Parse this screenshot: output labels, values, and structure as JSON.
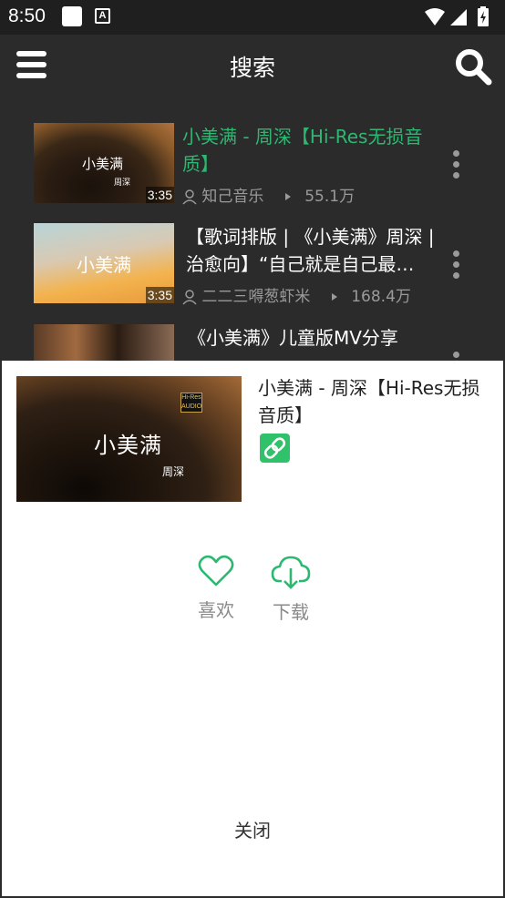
{
  "status_bar": {
    "time": "8:50",
    "a_icon": "A"
  },
  "app_bar": {
    "title": "搜索"
  },
  "results": [
    {
      "title": "小美满 - 周深【Hi-Res无损音质】",
      "duration": "3:35",
      "author": "知己音乐",
      "plays": "55.1万",
      "thumb_caption": "小美满",
      "thumb_sub": "周深",
      "active": true
    },
    {
      "title": "【歌词排版 | 《小美满》周深 | 治愈向】“自己就是自己最…",
      "duration": "3:35",
      "author": "二二三嘚葱虾米",
      "plays": "168.4万",
      "thumb_caption": "小美满",
      "active": false
    },
    {
      "title": "《小美满》儿童版MV分享",
      "active": false
    }
  ],
  "sheet": {
    "title": "小美满 - 周深【Hi-Res无损音质】",
    "thumb_caption": "小美满",
    "thumb_sub": "周深",
    "thumb_badge_1": "Hi-Res",
    "thumb_badge_2": "AUDIO",
    "like_label": "喜欢",
    "download_label": "下载",
    "close_label": "关闭"
  },
  "colors": {
    "accent": "#2db872",
    "link_button": "#2fc26a",
    "app_bar": "#2b2b2b"
  },
  "icons": [
    "menu-icon",
    "search-icon",
    "user-icon",
    "play-icon",
    "more-vertical-icon",
    "link-icon",
    "heart-icon",
    "cloud-download-icon"
  ]
}
